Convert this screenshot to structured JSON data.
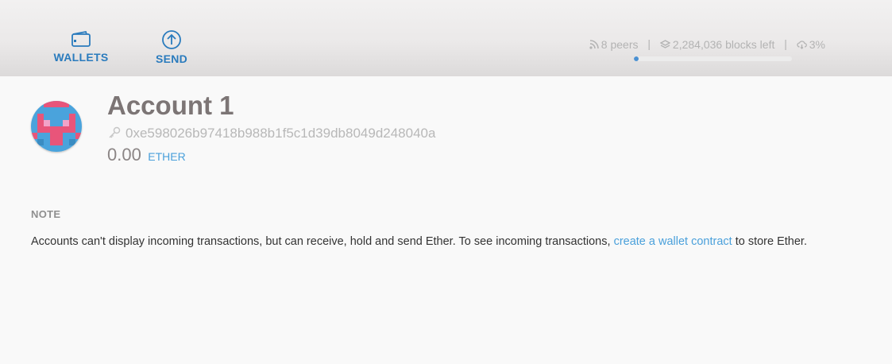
{
  "nav": {
    "wallets_label": "WALLETS",
    "send_label": "SEND"
  },
  "status": {
    "peers_text": "8 peers",
    "blocks_text": "2,284,036 blocks left",
    "sync_text": "3%",
    "separator": "|",
    "progress_fraction": 0.03
  },
  "account": {
    "name": "Account 1",
    "address": "0xe598026b97418b988b1f5c1d39db8049d248040a",
    "balance": "0.00",
    "unit": "ETHER"
  },
  "note": {
    "title": "NOTE",
    "text_before": "Accounts can't display incoming transactions, but can receive, hold and send Ether. To see incoming transactions,",
    "link": "create a wallet contract",
    "text_after": "to store Ether."
  },
  "colors": {
    "accent": "#2a7bbd",
    "link": "#4aa0db",
    "avatar_blue": "#4aa3dc",
    "avatar_pink": "#e8557a"
  }
}
